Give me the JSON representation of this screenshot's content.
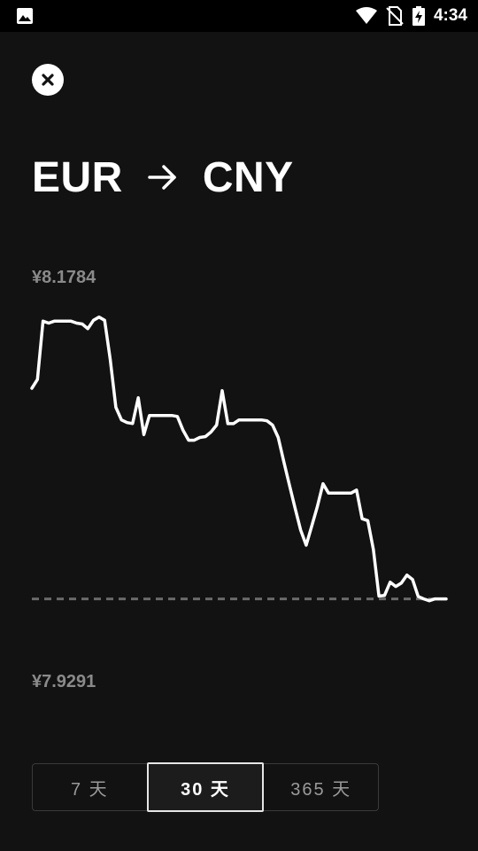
{
  "status_bar": {
    "time": "4:34",
    "icons": [
      "image-icon",
      "wifi-icon",
      "no-sim-icon",
      "battery-charging-icon"
    ]
  },
  "header": {
    "close_icon": "close-icon",
    "from_currency": "EUR",
    "arrow_icon": "arrow-right-icon",
    "to_currency": "CNY"
  },
  "chart": {
    "high_label": "¥8.1784",
    "low_label": "¥7.9291"
  },
  "range_selector": {
    "options": [
      "7 天",
      "30 天",
      "365 天"
    ],
    "selected": "30 天"
  },
  "colors": {
    "background": "#121212",
    "line": "#ffffff",
    "muted_text": "#8a8a8a"
  },
  "chart_data": {
    "type": "line",
    "ylim": [
      7.9291,
      8.1784
    ],
    "series": [
      {
        "values": [
          8.1231,
          8.1287,
          8.1658,
          8.1646,
          8.1658,
          8.1658,
          8.1658,
          8.1658,
          8.1646,
          8.164,
          8.161,
          8.1664,
          8.1684,
          8.1664,
          8.1416,
          8.111,
          8.103,
          8.1013,
          8.1007,
          8.1171,
          8.0936,
          8.1058,
          8.1058,
          8.1058,
          8.1058,
          8.1058,
          8.1052,
          8.0964,
          8.0901,
          8.0901,
          8.0918,
          8.0924,
          8.0953,
          8.0997,
          8.1216,
          8.1006,
          8.1006,
          8.103,
          8.103,
          8.103,
          8.103,
          8.103,
          8.1024,
          8.0997,
          8.0918,
          8.0765,
          8.0617,
          8.0472,
          8.033,
          8.0233,
          8.0355,
          8.0478,
          8.0624,
          8.0564,
          8.0564,
          8.0564,
          8.0564,
          8.0564,
          8.0584,
          8.0401,
          8.0389,
          8.0206,
          7.9909,
          7.9913,
          7.9998,
          7.997,
          7.9992,
          8.0043,
          8.0014,
          7.9907,
          7.9891,
          7.9879,
          7.9891,
          7.9891,
          7.9891
        ]
      }
    ],
    "reference_line": {
      "style": "dashed",
      "value": 7.9891
    }
  }
}
